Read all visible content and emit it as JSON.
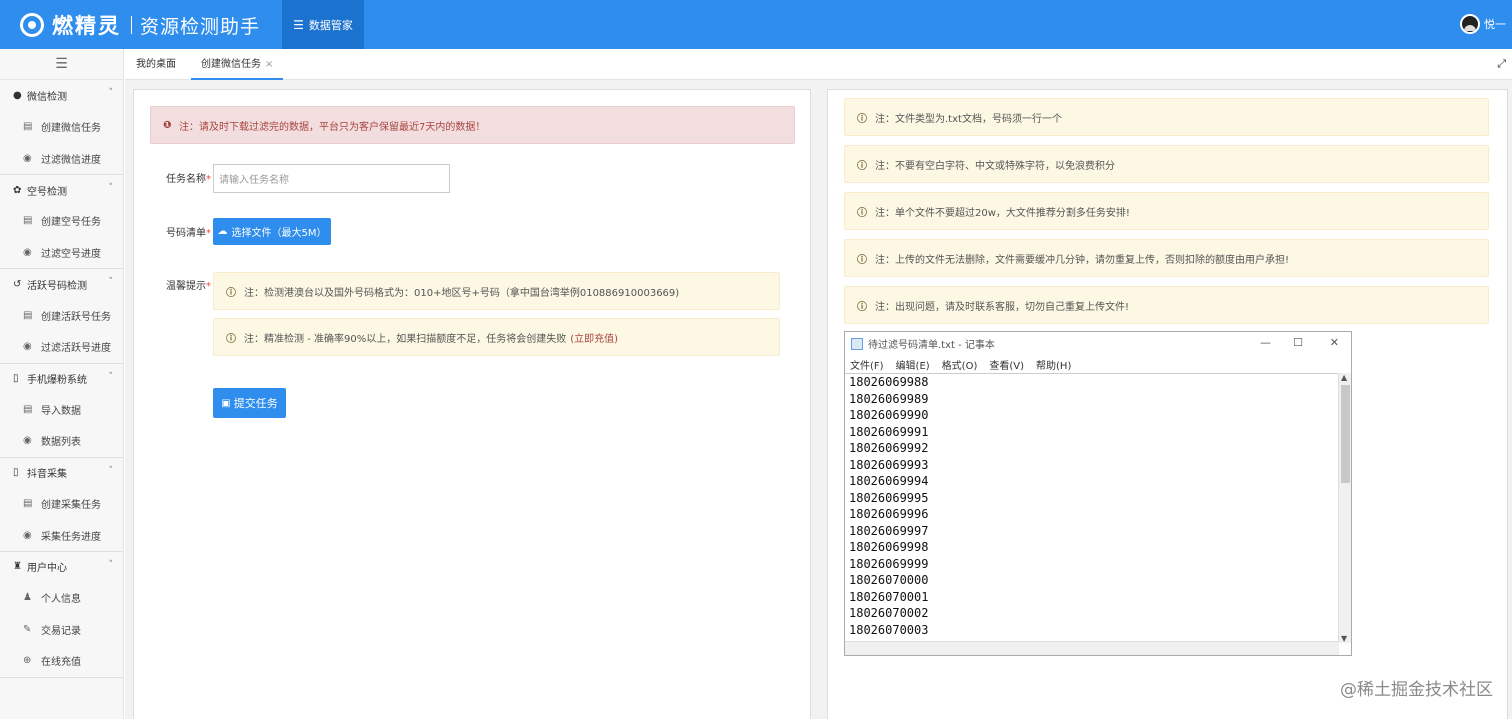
{
  "header": {
    "logo_name": "燃精灵",
    "logo_sub": "资源检测助手",
    "nav_label": "数据管家",
    "user_name": "悦一"
  },
  "sidebar": {
    "groups": [
      {
        "label": "微信检测",
        "items": [
          {
            "label": "创建微信任务"
          },
          {
            "label": "过滤微信进度"
          }
        ]
      },
      {
        "label": "空号检测",
        "items": [
          {
            "label": "创建空号任务"
          },
          {
            "label": "过滤空号进度"
          }
        ]
      },
      {
        "label": "活跃号码检测",
        "items": [
          {
            "label": "创建活跃号任务"
          },
          {
            "label": "过滤活跃号进度"
          }
        ]
      },
      {
        "label": "手机爆粉系统",
        "items": [
          {
            "label": "导入数据"
          },
          {
            "label": "数据列表"
          }
        ]
      },
      {
        "label": "抖音采集",
        "items": [
          {
            "label": "创建采集任务"
          },
          {
            "label": "采集任务进度"
          }
        ]
      },
      {
        "label": "用户中心",
        "items": [
          {
            "label": "个人信息"
          },
          {
            "label": "交易记录"
          },
          {
            "label": "在线充值"
          }
        ]
      }
    ]
  },
  "tabs": [
    {
      "label": "我的桌面"
    },
    {
      "label": "创建微信任务",
      "close": "×"
    }
  ],
  "form": {
    "alert_danger": "注：请及时下载过滤完的数据，平台只为客户保留最近7天内的数据！",
    "task_name_label": "任务名称",
    "task_name_placeholder": "请输入任务名称",
    "number_list_label": "号码清单",
    "file_button": "选择文件（最大5M）",
    "tips_label": "温馨提示",
    "tip1": "注：检测港澳台以及国外号码格式为：010+地区号+号码（拿中国台湾举例010886910003669)",
    "tip2": "注：精准检测 - 准确率90%以上，如果扫描额度不足，任务将会创建失败",
    "tip2_link": "立即充值",
    "submit": "提交任务",
    "required_mark": "*"
  },
  "notes": [
    "注：文件类型为.txt文档，号码须一行一个",
    "注：不要有空白字符、中文或特殊字符，以免浪费积分",
    "注：单个文件不要超过20w，大文件推荐分割多任务安排!",
    "注：上传的文件无法删除，文件需要缓冲几分钟，请勿重复上传，否则扣除的额度由用户承担!",
    "注：出现问题，请及时联系客服，切勿自己重复上传文件!"
  ],
  "notepad": {
    "title": "待过滤号码清单.txt - 记事本",
    "menu": [
      "文件(F)",
      "编辑(E)",
      "格式(O)",
      "查看(V)",
      "帮助(H)"
    ],
    "lines": [
      "18026069988",
      "18026069989",
      "18026069990",
      "18026069991",
      "18026069992",
      "18026069993",
      "18026069994",
      "18026069995",
      "18026069996",
      "18026069997",
      "18026069998",
      "18026069999",
      "18026070000",
      "18026070001",
      "18026070002",
      "18026070003"
    ]
  },
  "watermark": "@稀土掘金技术社区",
  "colors": {
    "primary": "#2e8ded",
    "danger_bg": "#f2dede",
    "warning_bg": "#fcf8e3"
  }
}
